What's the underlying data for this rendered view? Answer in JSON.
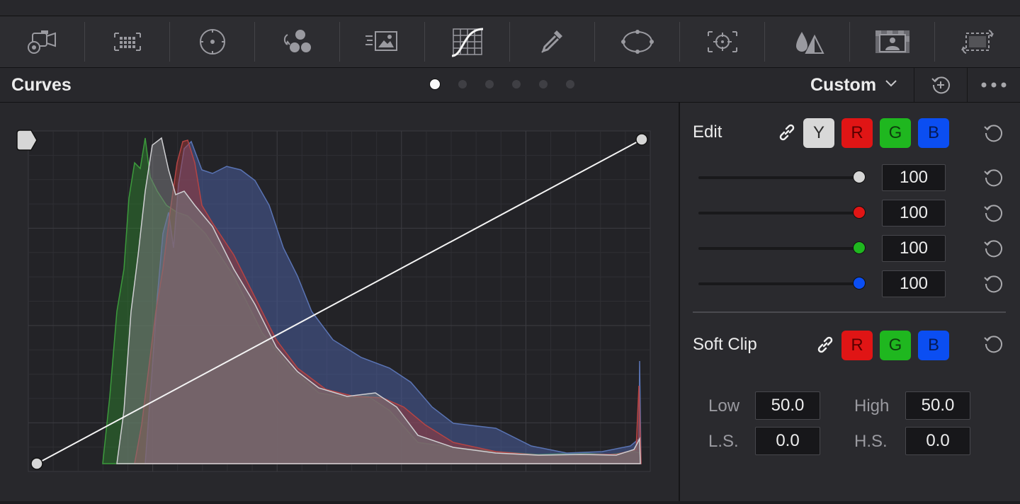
{
  "toolbar": {
    "tools": [
      {
        "name": "camera-raw-icon",
        "active": false
      },
      {
        "name": "color-match-icon",
        "active": false
      },
      {
        "name": "color-wheels-icon",
        "active": false
      },
      {
        "name": "rgb-mixer-icon",
        "active": false
      },
      {
        "name": "motion-effects-icon",
        "active": false
      },
      {
        "name": "curves-icon",
        "active": true
      },
      {
        "name": "qualifier-eyedropper-icon",
        "active": false
      },
      {
        "name": "power-window-icon",
        "active": false
      },
      {
        "name": "tracker-icon",
        "active": false
      },
      {
        "name": "blur-icon",
        "active": false
      },
      {
        "name": "key-icon",
        "active": false
      },
      {
        "name": "sizing-icon",
        "active": false
      }
    ]
  },
  "header": {
    "title": "Curves",
    "page_dots": {
      "count": 6,
      "active_index": 0
    },
    "mode": "Custom",
    "mode_chevron_icon": "chevron-down-icon",
    "reset_all_icon": "reset-all-icon",
    "more_icon": "more-options-icon"
  },
  "curve_editor": {
    "handle_icon": "curve-menu-handle-icon",
    "curve_start": [
      0,
      0
    ],
    "curve_end": [
      1,
      1
    ],
    "histogram_colors": {
      "luma": "#8a8a8e",
      "red": "#a33a3a",
      "green": "#2e8a2e",
      "blue": "#4a5f9e"
    }
  },
  "edit": {
    "label": "Edit",
    "link_icon": "link-icon",
    "channels": [
      {
        "key": "y",
        "label": "Y"
      },
      {
        "key": "r",
        "label": "R"
      },
      {
        "key": "g",
        "label": "G"
      },
      {
        "key": "b",
        "label": "B"
      }
    ],
    "reset_icon": "reset-icon",
    "sliders": [
      {
        "channel": "Y",
        "value": "100",
        "level": 1.0,
        "thumb_color": "#d6d6d6"
      },
      {
        "channel": "R",
        "value": "100",
        "level": 1.0,
        "thumb_color": "#e01515"
      },
      {
        "channel": "G",
        "value": "100",
        "level": 1.0,
        "thumb_color": "#1fb71f"
      },
      {
        "channel": "B",
        "value": "100",
        "level": 1.0,
        "thumb_color": "#0b4ef2"
      }
    ]
  },
  "soft_clip": {
    "label": "Soft Clip",
    "link_icon": "link-icon",
    "channels": [
      {
        "key": "r",
        "label": "R"
      },
      {
        "key": "g",
        "label": "G"
      },
      {
        "key": "b",
        "label": "B"
      }
    ],
    "reset_icon": "reset-icon",
    "low_label": "Low",
    "low_value": "50.0",
    "high_label": "High",
    "high_value": "50.0",
    "ls_label": "L.S.",
    "ls_value": "0.0",
    "hs_label": "H.S.",
    "hs_value": "0.0"
  }
}
